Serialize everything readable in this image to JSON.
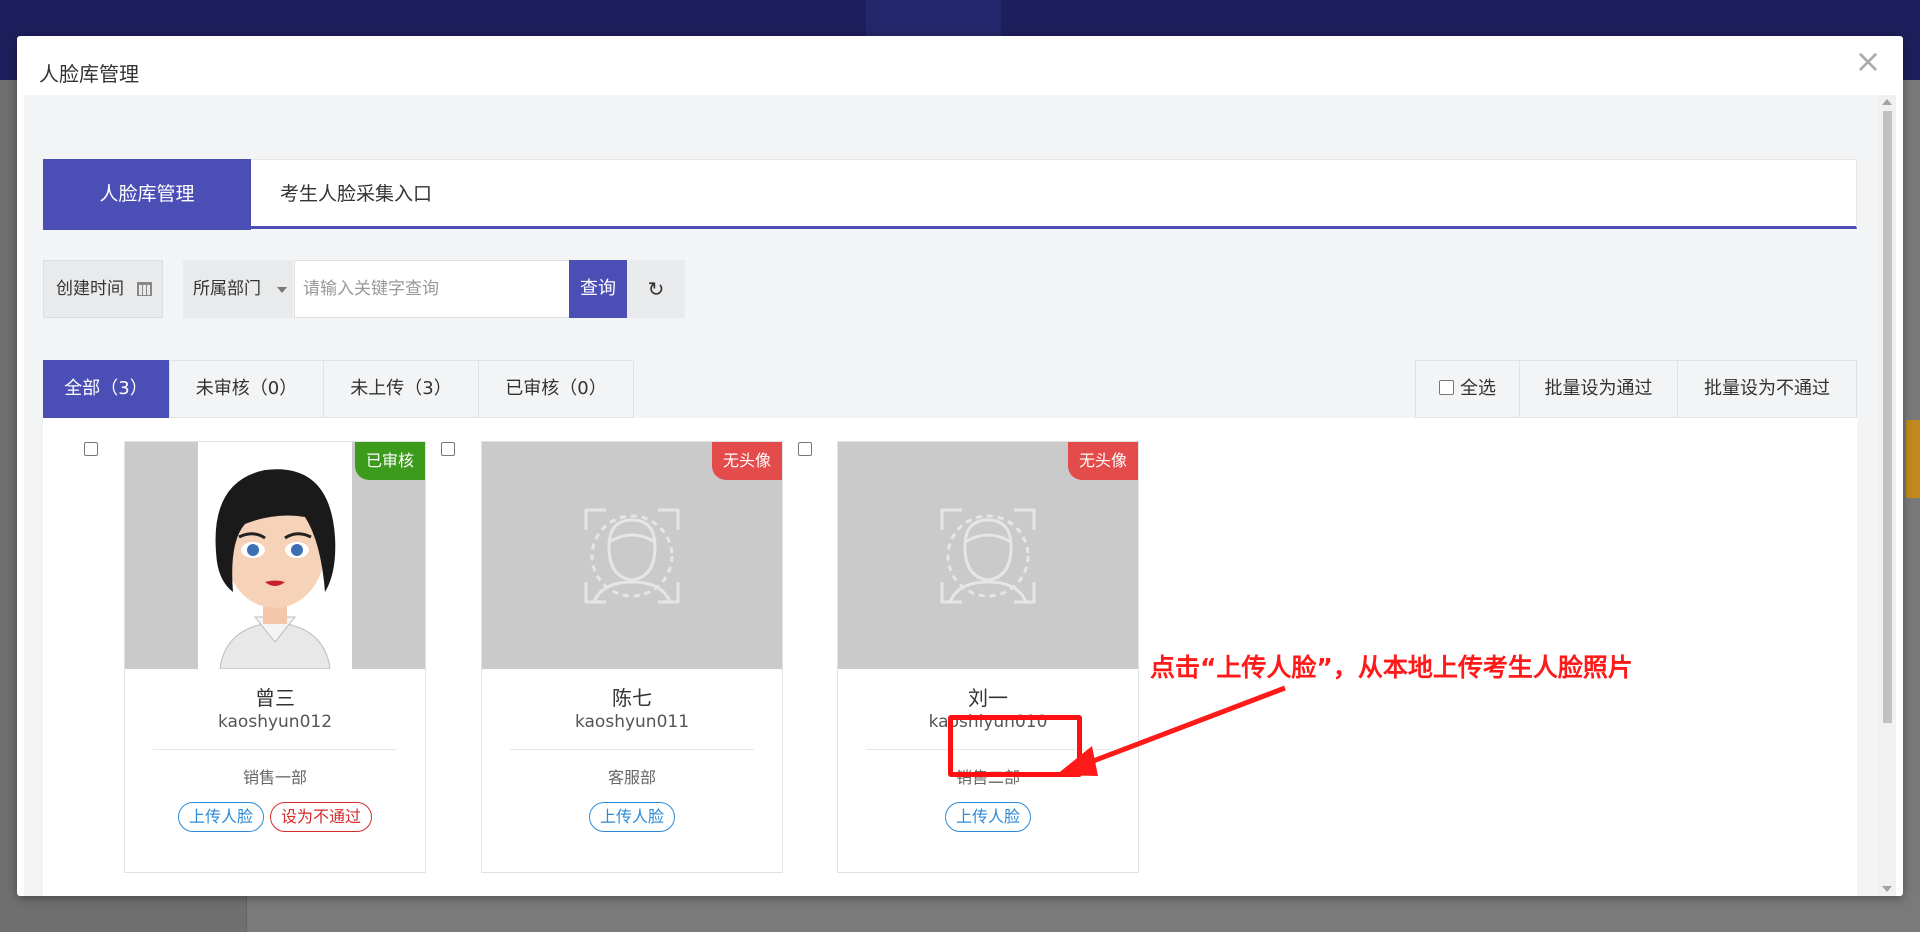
{
  "modal": {
    "title": "人脸库管理",
    "close_icon": "×"
  },
  "tabs": [
    {
      "label": "人脸库管理"
    },
    {
      "label": "考生人脸采集入口"
    }
  ],
  "filters": {
    "created_time": "创建时间",
    "department": "所属部门",
    "search_placeholder": "请输入关键字查询",
    "query_button": "查询",
    "reset_icon": "↻"
  },
  "status_tabs": [
    {
      "label": "全部（3）"
    },
    {
      "label": "未审核（0）"
    },
    {
      "label": "未上传（3）"
    },
    {
      "label": "已审核（0）"
    }
  ],
  "bulk_actions": {
    "select_all": "全选",
    "batch_pass": "批量设为通过",
    "batch_reject": "批量设为不通过"
  },
  "cards": [
    {
      "badge": "已审核",
      "name": "曾三",
      "account": "kaoshyun012",
      "department": "销售一部",
      "upload_button": "上传人脸",
      "reject_button": "设为不通过"
    },
    {
      "badge": "无头像",
      "name": "陈七",
      "account": "kaoshyun011",
      "department": "客服部",
      "upload_button": "上传人脸"
    },
    {
      "badge": "无头像",
      "name": "刘一",
      "account": "kaoshiyun010",
      "department": "销售二部",
      "upload_button": "上传人脸"
    }
  ],
  "annotation": {
    "text": "点击“上传人脸”，从本地上传考生人脸照片",
    "color": "#ff1a1a"
  },
  "colors": {
    "primary": "#4b4fb5",
    "approved_badge": "#3c9a1d",
    "no_avatar_badge": "#e44b4b",
    "link_blue": "#2d8ad8",
    "danger_red": "#d62c2c"
  }
}
